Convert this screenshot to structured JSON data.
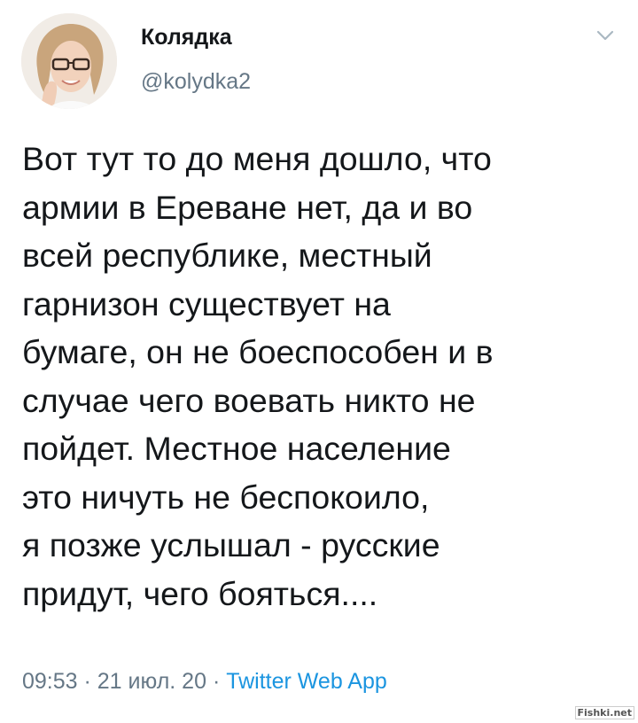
{
  "tweet": {
    "author": {
      "display_name": "Колядка",
      "handle": "@kolydka2"
    },
    "text_lines": [
      "Вот тут то до меня дошло, что",
      "армии в Ереване нет, да и во",
      "всей республике, местный",
      "гарнизон существует на",
      "бумаге, он не боеспособен и в",
      "случае чего воевать никто не",
      "пойдет. Местное население",
      "это ничуть не беспокоило,",
      "я позже услышал - русские",
      "придут, чего бояться...."
    ],
    "meta": {
      "time": "09:53",
      "separator": " · ",
      "date": "21 июл. 20",
      "source": "Twitter Web App"
    },
    "menu_icon": "chevron-down-icon"
  },
  "watermark": {
    "text": "Fishki.net"
  },
  "colors": {
    "text": "#14171a",
    "secondary": "#657786",
    "link": "#1b95e0",
    "background": "#ffffff"
  }
}
